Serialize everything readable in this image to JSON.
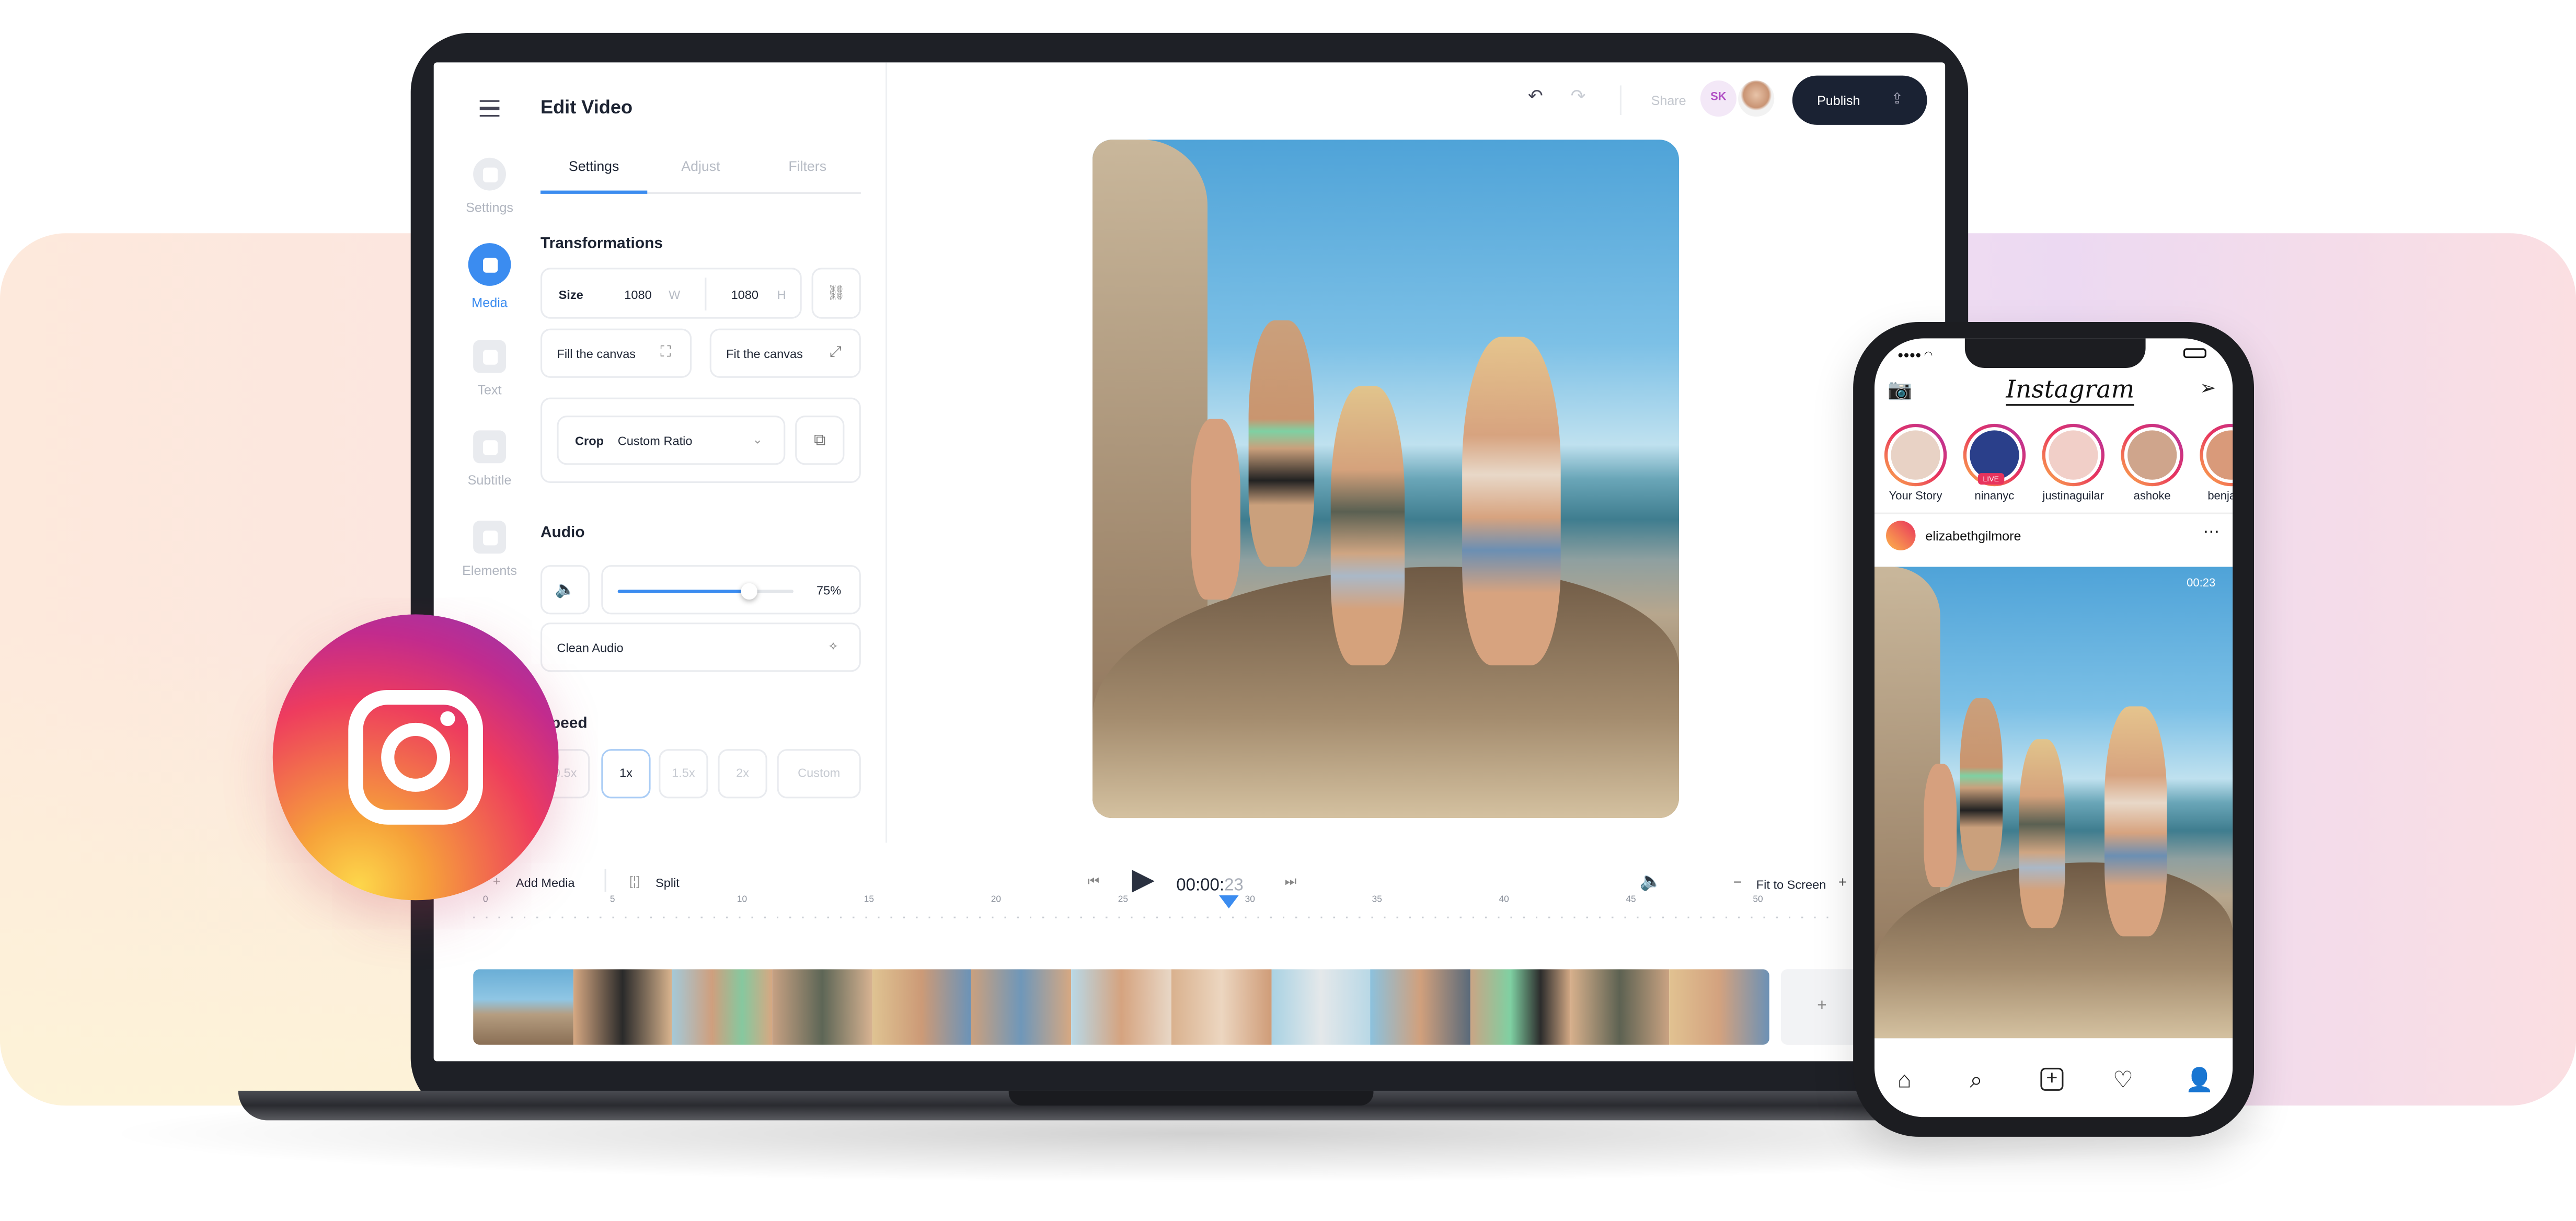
{
  "editor": {
    "title": "Edit Video",
    "tabs": [
      "Settings",
      "Adjust",
      "Filters"
    ],
    "nav": [
      "Settings",
      "Media",
      "Text",
      "Subtitle",
      "Elements"
    ],
    "transformations": {
      "heading": "Transformations",
      "size_label": "Size",
      "width": "1080",
      "width_unit": "W",
      "height": "1080",
      "height_unit": "H",
      "fill": "Fill the canvas",
      "fit": "Fit the canvas",
      "crop_label": "Crop",
      "crop_value": "Custom Ratio"
    },
    "audio": {
      "heading": "Audio",
      "volume": "75%",
      "volume_fraction": 0.75,
      "clean": "Clean Audio"
    },
    "speed": {
      "heading": "Speed",
      "options": [
        "0.5x",
        "1x",
        "1.5x",
        "2x",
        "Custom"
      ],
      "selected": "1x"
    },
    "share": "Share",
    "user_initials": "SK",
    "publish": "Publish"
  },
  "timeline": {
    "add_media": "Add Media",
    "split": "Split",
    "time_main": "00:00:",
    "time_frames": "23",
    "fit": "Fit to Screen",
    "ticks": [
      "0",
      "5",
      "10",
      "15",
      "20",
      "25",
      "30",
      "35",
      "40",
      "45",
      "50"
    ],
    "playhead_tick": "30"
  },
  "instagram": {
    "logo": "Instagram",
    "stories": [
      "Your Story",
      "ninanyc",
      "justinaguilar",
      "ashoke",
      "benjamin"
    ],
    "live_badge": "LIVE",
    "post_user": "elizabethgilmore",
    "post_time": "00:23"
  },
  "colors": {
    "accent": "#3b8cf0",
    "publish_bg": "#1a2233"
  }
}
